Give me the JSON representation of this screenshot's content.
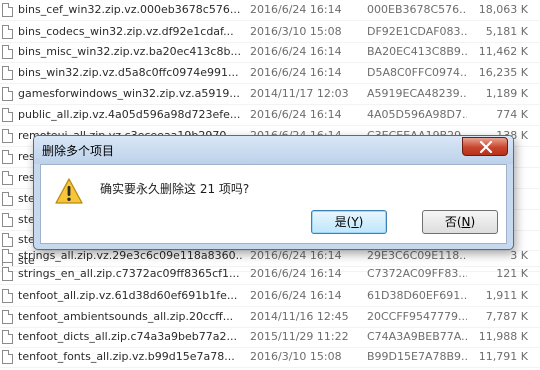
{
  "file_list": {
    "rows": [
      {
        "name": "bins_cef_win32.zip.vz.000eb3678c576...",
        "date": "2016/6/24 16:14",
        "hash": "000EB3678C576...",
        "size": "18,063 K"
      },
      {
        "name": "bins_codecs_win32.zip.vz.df92e1cdaf...",
        "date": "2016/3/10 15:08",
        "hash": "DF92E1CDAF083...",
        "size": "5,181 K"
      },
      {
        "name": "bins_misc_win32.zip.vz.ba20ec413c8b...",
        "date": "2016/6/24 16:14",
        "hash": "BA20EC413C8B9...",
        "size": "11,462 K"
      },
      {
        "name": "bins_win32.zip.vz.d5a8c0ffc0974e991...",
        "date": "2016/6/24 16:14",
        "hash": "D5A8C0FFC0974...",
        "size": "16,235 K"
      },
      {
        "name": "gamesforwindows_win32.zip.vz.a5919...",
        "date": "2014/11/17 12:03",
        "hash": "A5919ECA48239...",
        "size": "1,189 K"
      },
      {
        "name": "public_all.zip.vz.4a05d596a98d723efe...",
        "date": "2016/6/24 16:14",
        "hash": "4A05D596A98D7...",
        "size": "774 K"
      },
      {
        "name": "remoteui_all.zip.vz.c3eceeaa19b2970...",
        "date": "2016/6/24 16:14",
        "hash": "C3ECEEAA19B29...",
        "size": "138 K"
      },
      {
        "name": "res",
        "date": "",
        "hash": "",
        "size": ""
      },
      {
        "name": "res",
        "date": "",
        "hash": "",
        "size": ""
      },
      {
        "name": "ste",
        "date": "",
        "hash": "",
        "size": ""
      },
      {
        "name": "ste",
        "date": "",
        "hash": "",
        "size": ""
      },
      {
        "name": "ste",
        "date": "",
        "hash": "",
        "size": ""
      },
      {
        "name": "ste",
        "date": "",
        "hash": "",
        "size": ""
      },
      {
        "name": "strings_all.zip.vz.29e3c6c09e118a8360...",
        "date": "2016/6/24 16:14",
        "hash": "29E3C6C09E118...",
        "size": "3 K"
      },
      {
        "name": "strings_en_all.zip.c7372ac09ff8365cf1...",
        "date": "2016/6/24 16:14",
        "hash": "C7372AC09FF83...",
        "size": "121 K"
      },
      {
        "name": "tenfoot_all.zip.vz.61d38d60ef691b1fe...",
        "date": "2016/6/24 16:14",
        "hash": "61D38D60EF691...",
        "size": "1,911 K"
      },
      {
        "name": "tenfoot_ambientsounds_all.zip.20ccff...",
        "date": "2014/11/16 12:45",
        "hash": "20CCFF9547779...",
        "size": "7,787 K"
      },
      {
        "name": "tenfoot_dicts_all.zip.c74a3a9beb77a2...",
        "date": "2015/11/29 11:22",
        "hash": "C74A3A9BEB77A...",
        "size": "11,988 K"
      },
      {
        "name": "tenfoot_fonts_all.zip.vz.b99d15e7a78...",
        "date": "2016/3/10 15:08",
        "hash": "B99D15E7A78B9...",
        "size": "11,791 K"
      }
    ]
  },
  "dialog": {
    "title": "删除多个项目",
    "message": "确实要永久删除这 21 项吗?",
    "yes_label": "是(",
    "yes_key": "Y",
    "yes_close": ")",
    "no_label": "否(",
    "no_key": "N",
    "no_close": ")"
  },
  "colors": {
    "dialog_frame": "#c7d9ee",
    "close_button": "#c9452d",
    "default_button": "#bee6fd"
  },
  "icons": {
    "file": "file-icon",
    "warning": "warning-icon",
    "close": "close-icon"
  }
}
